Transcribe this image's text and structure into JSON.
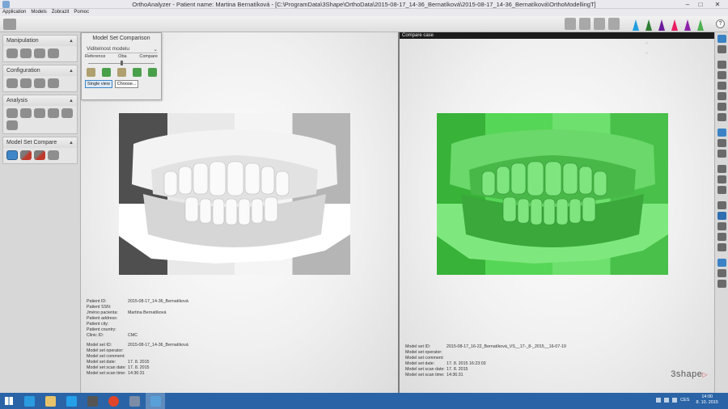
{
  "window": {
    "title": "OrthoAnalyzer - Patient name: Martina Bernatíková - [C:\\ProgramData\\3Shape\\OrthoData\\2015-08-17_14-36_Bernatíková\\2015-08-17_14-36_Bernatíková\\OrthoModellingT]",
    "minimize": "–",
    "maximize": "□",
    "close": "✕"
  },
  "menu": [
    "Application",
    "Models",
    "Zobrazit",
    "Pomoc"
  ],
  "toolbar": {
    "help": "?",
    "cone_colors": [
      "#1f9ee0",
      "#2e7d32",
      "#6a1b9a",
      "#e91e63",
      "#8e24aa",
      "#4caf50"
    ]
  },
  "left_panel": {
    "sections": [
      {
        "title": "Manipulation",
        "chevron": "▲"
      },
      {
        "title": "Configuration",
        "chevron": "▲"
      },
      {
        "title": "Analysis",
        "chevron": "▲"
      },
      {
        "title": "Model Set Compare",
        "chevron": "▲"
      }
    ]
  },
  "popup": {
    "title": "Model Set Comparison",
    "selector_value": "Viditelnost modelu",
    "selector_chevron": "⌄",
    "label_reference": "Reference",
    "label_both": "Oba",
    "label_compare": "Compare",
    "slider_fraction": 0.5,
    "single_view": "Single view",
    "choose": "Choose..."
  },
  "right_viewport": {
    "header": "Compare case"
  },
  "left_info": {
    "patient": [
      {
        "label": "Patient ID:",
        "value": "2015-08-17_14-36_Bernatíková"
      },
      {
        "label": "Patient SSN:",
        "value": ""
      },
      {
        "label": "Jméno pacienta:",
        "value": "Martina Bernatíková"
      },
      {
        "label": "Patient address:",
        "value": ""
      },
      {
        "label": "Patient city:",
        "value": ""
      },
      {
        "label": "Patient country:",
        "value": ""
      },
      {
        "label": "Clinic ID:",
        "value": "CMC"
      }
    ],
    "model": [
      {
        "label": "Model set ID:",
        "value": "2015-08-17_14-36_Bernatíková"
      },
      {
        "label": "Model set operator:",
        "value": ""
      },
      {
        "label": "Model set comment:",
        "value": ""
      },
      {
        "label": "Model set date:",
        "value": "17. 8. 2015"
      },
      {
        "label": "Model set scan date:",
        "value": "17. 8. 2015"
      },
      {
        "label": "Model set scan time:",
        "value": "14:36:31"
      }
    ]
  },
  "right_info": {
    "model": [
      {
        "label": "Model set ID:",
        "value": "2015-08-17_16-22_Bernatíková_VS__17-_8-_2015__16-07-19"
      },
      {
        "label": "Model set operator:",
        "value": ""
      },
      {
        "label": "Model set comment:",
        "value": ""
      },
      {
        "label": "Model set date:",
        "value": "17. 8. 2015 16:23:03"
      },
      {
        "label": "Model set scan date:",
        "value": "17. 8. 2015"
      },
      {
        "label": "Model set scan time:",
        "value": "14:36:31"
      }
    ]
  },
  "logo": {
    "text": "3shape",
    "mark": "▷"
  },
  "taskbar": {
    "language": "CES",
    "time": "14:00",
    "date": "8. 10. 2015",
    "app_colors": [
      "#2b9be0",
      "#e6c36a",
      "#25a0e8",
      "#555555",
      "#e0452b",
      "#7b8da6",
      "#5aa0d8"
    ]
  }
}
